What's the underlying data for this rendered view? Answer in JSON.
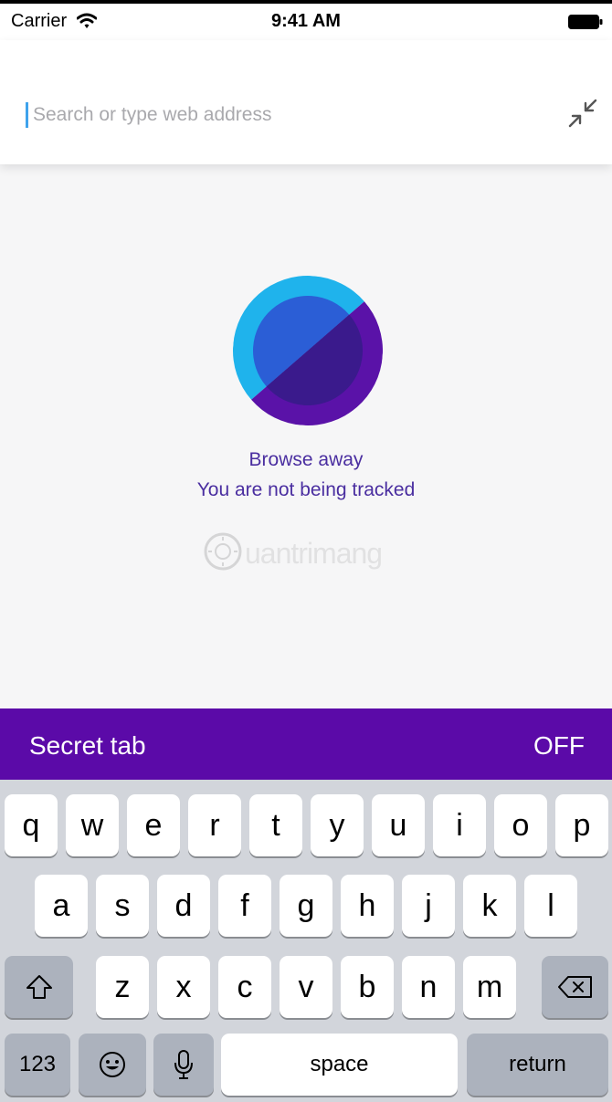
{
  "status_bar": {
    "carrier": "Carrier",
    "time": "9:41 AM",
    "icons": [
      "wifi-icon",
      "battery-icon"
    ]
  },
  "url_bar": {
    "placeholder": "Search or type web address",
    "value": "",
    "icon": "shrink-arrows-icon"
  },
  "private_message": {
    "line1": "Browse away",
    "line2": "You are not being tracked",
    "logo": "private-browsing-logo"
  },
  "watermark": {
    "text": "uantrimang"
  },
  "secret_tab": {
    "label": "Secret tab",
    "state": "OFF"
  },
  "keyboard": {
    "row1": [
      "q",
      "w",
      "e",
      "r",
      "t",
      "y",
      "u",
      "i",
      "o",
      "p"
    ],
    "row2": [
      "a",
      "s",
      "d",
      "f",
      "g",
      "h",
      "j",
      "k",
      "l"
    ],
    "row3": [
      "z",
      "x",
      "c",
      "v",
      "b",
      "n",
      "m"
    ],
    "numbers_key": "123",
    "space_key": "space",
    "return_key": "return",
    "icons": [
      "shift-icon",
      "backspace-icon",
      "emoji-icon",
      "microphone-icon"
    ]
  },
  "colors": {
    "secret_bar": "#5b0aa8",
    "message_text": "#4a2ea0",
    "caret": "#3fa3ec",
    "logo_light_blue": "#1fb3ec",
    "logo_blue": "#2b5ed6",
    "logo_purple": "#5a12a8",
    "logo_dark_purple": "#3a1a8c"
  }
}
